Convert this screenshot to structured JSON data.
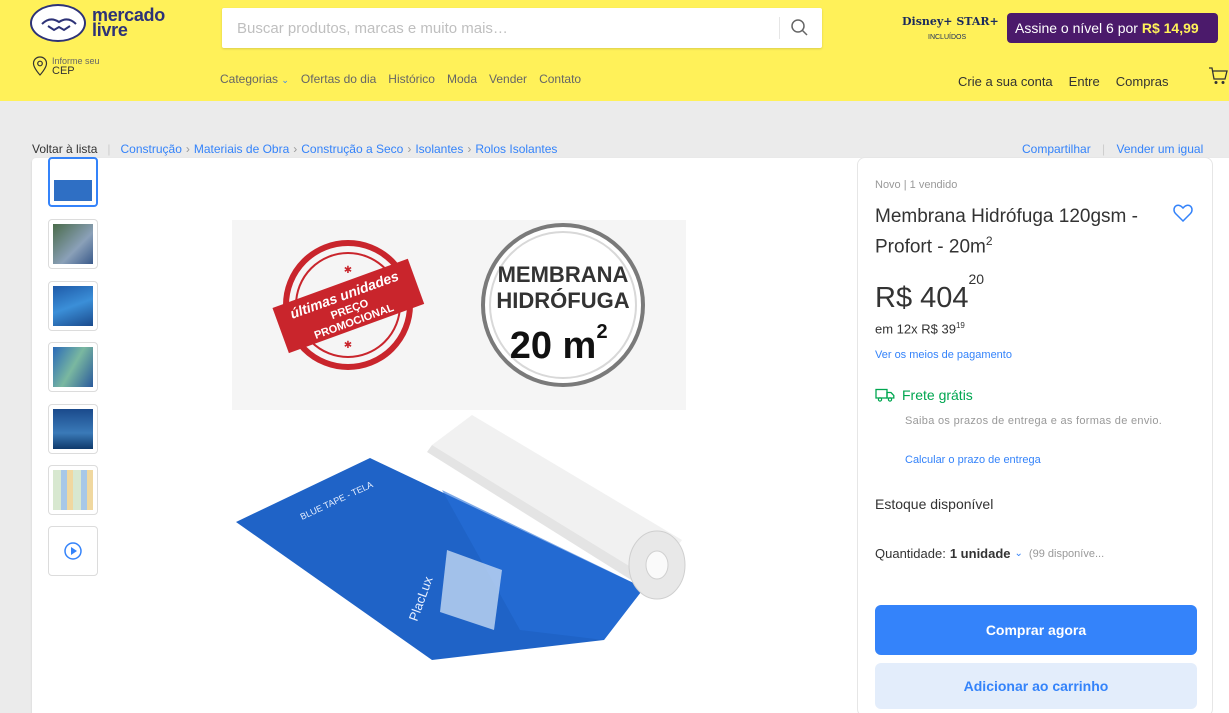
{
  "header": {
    "logo_line1": "mercado",
    "logo_line2": "livre",
    "search_placeholder": "Buscar produtos, marcas e muito mais…",
    "disney_brand": "Disney+ STAR+",
    "disney_sub": "INCLUÍDOS",
    "promo_text": "Assine o nível 6 por ",
    "promo_price": "R$ 14,99",
    "location_line1": "Informe seu",
    "location_line2": "CEP",
    "nav": [
      "Categorias",
      "Ofertas do dia",
      "Histórico",
      "Moda",
      "Vender",
      "Contato"
    ],
    "user_nav": [
      "Crie a sua conta",
      "Entre",
      "Compras"
    ]
  },
  "breadcrumb": {
    "back": "Voltar à lista",
    "items": [
      "Construção",
      "Materiais de Obra",
      "Construção a Seco",
      "Isolantes",
      "Rolos Isolantes"
    ],
    "share": "Compartilhar",
    "sell": "Vender um igual"
  },
  "gallery": {
    "thumbnail_count": 7,
    "badge_line1": "últimas unidades",
    "badge_line2": "PREÇO",
    "badge_line3": "PROMOCIONAL",
    "seal_line1": "MEMBRANA",
    "seal_line2": "HIDRÓFUGA",
    "seal_line3": "20 m",
    "seal_sup": "2",
    "roll_print": "BLUE TAPE - TELA",
    "roll_brand": "PlacLux"
  },
  "product": {
    "condition": "Novo | 1 vendido",
    "title": "Membrana Hidrófuga 120gsm - Profort - 20m",
    "title_sup": "2",
    "price_main": "R$ 404",
    "price_cents": "20",
    "installments": "em 12x R$ 39",
    "installments_cents": "19",
    "payment_link": "Ver os meios de pagamento",
    "shipping": "Frete grátis",
    "shipping_desc": "Saiba os prazos de entrega e as formas de envio.",
    "calc_link": "Calcular o prazo de entrega",
    "stock": "Estoque disponível",
    "qty_label": "Quantidade:",
    "qty_value": "1 unidade",
    "qty_avail": "(99 disponíve...",
    "buy_button": "Comprar agora",
    "cart_button": "Adicionar ao carrinho"
  },
  "colors": {
    "header_bg": "#fff159",
    "accent": "#3483fa",
    "shipping": "#00a650",
    "promo_bg": "#4b1a6b"
  }
}
